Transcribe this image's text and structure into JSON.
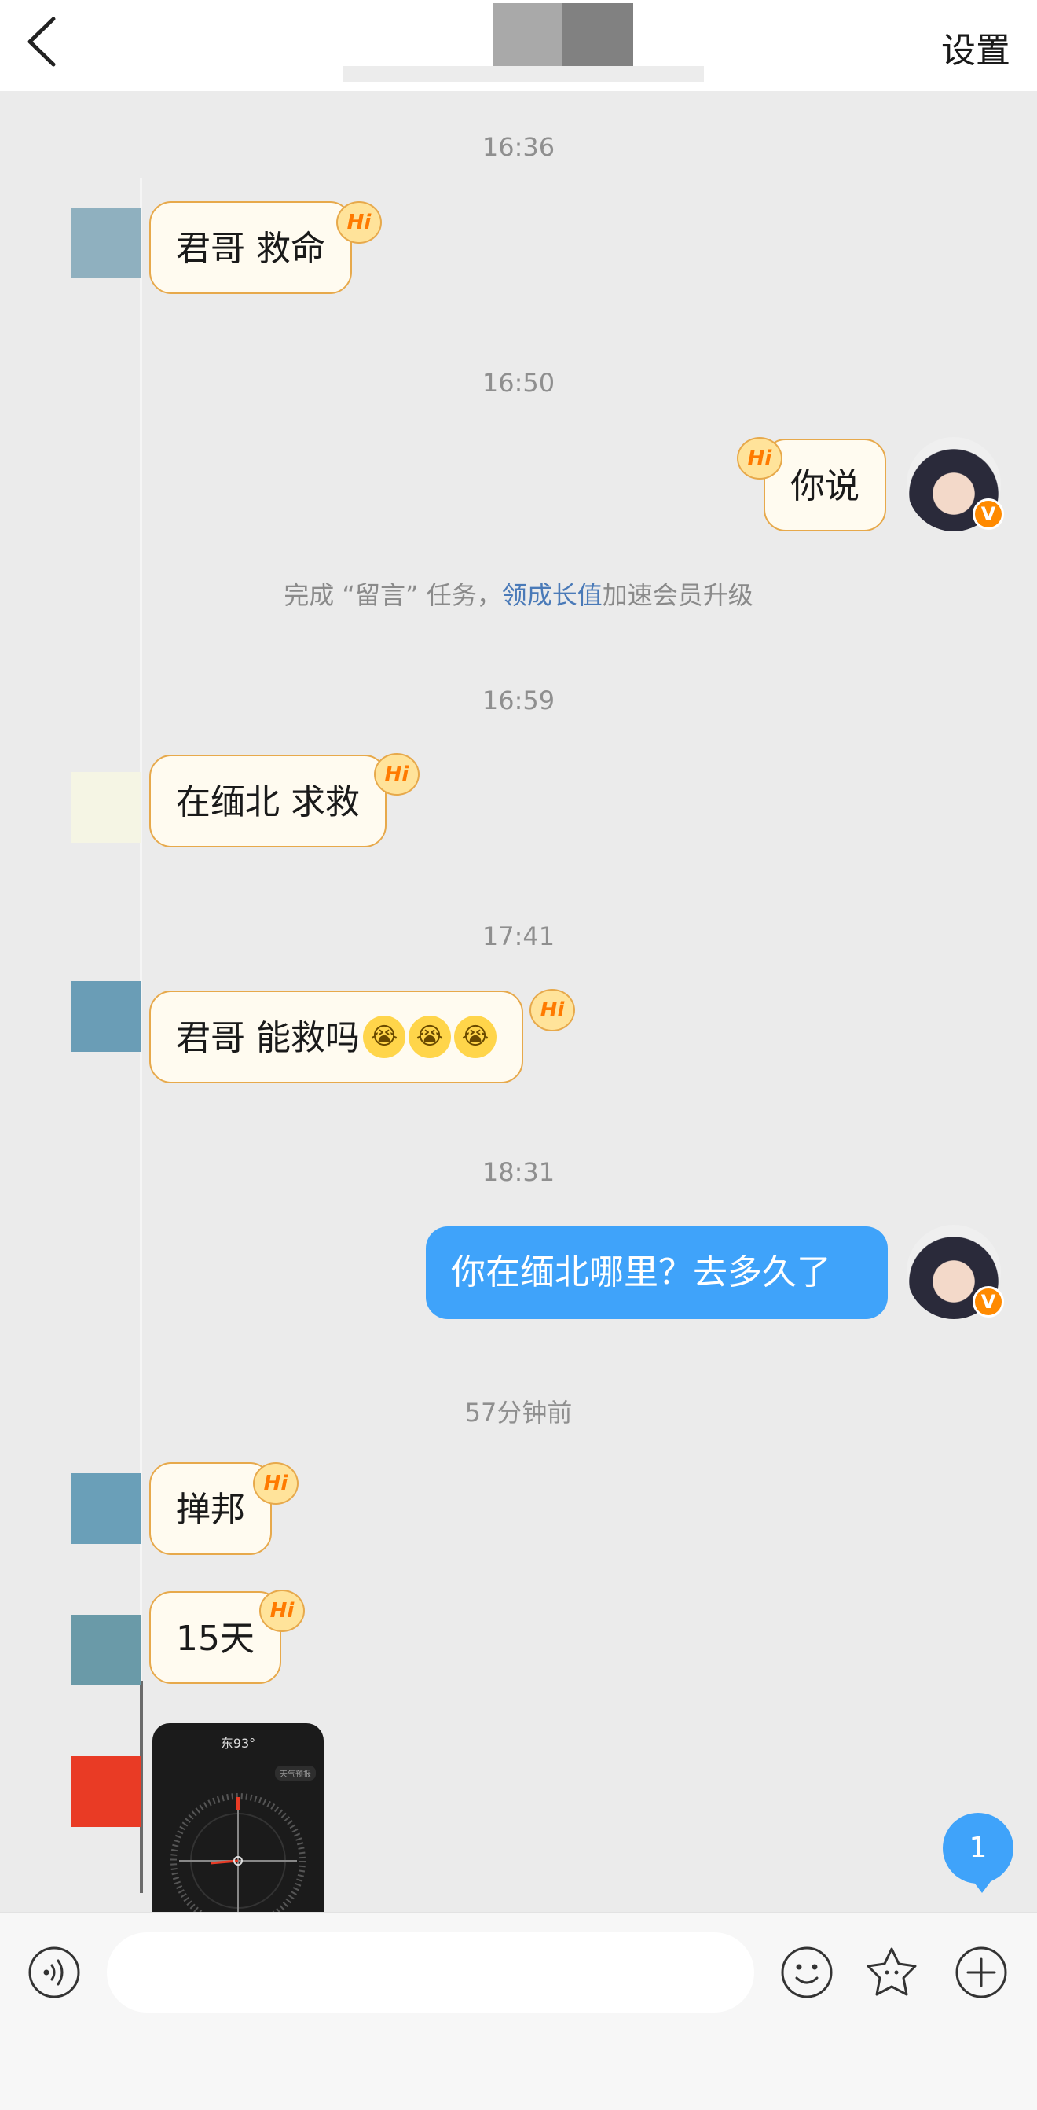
{
  "header": {
    "settings_label": "设置"
  },
  "timestamps": [
    "16:36",
    "16:50",
    "16:59",
    "17:41",
    "18:31",
    "57分钟前"
  ],
  "messages": [
    {
      "text": "君哥 救命"
    },
    {
      "text": "你说"
    },
    {
      "text": "在缅北 求救"
    },
    {
      "text": "君哥 能救吗"
    },
    {
      "text": "你在缅北哪里？去多久了"
    },
    {
      "text": "掸邦"
    },
    {
      "text": "15天"
    }
  ],
  "hi_badge": "Hi",
  "system_notice": {
    "prefix": "完成 “留言” 任务，",
    "link": "领成长值",
    "suffix": "加速会员升级"
  },
  "emoji": [
    "😭",
    "😭",
    "😭"
  ],
  "vip_badge": "V",
  "image_preview": {
    "title": "东93°",
    "tag": "天气预报"
  },
  "new_message_count": "1",
  "colors": {
    "accent": "#3fa3fa",
    "bubble_border": "#e7a94b",
    "link": "#4a7ab8"
  },
  "icons": [
    "back-arrow-icon",
    "voice-icon",
    "emoji-face-icon",
    "sticker-star-icon",
    "plus-circle-icon"
  ]
}
